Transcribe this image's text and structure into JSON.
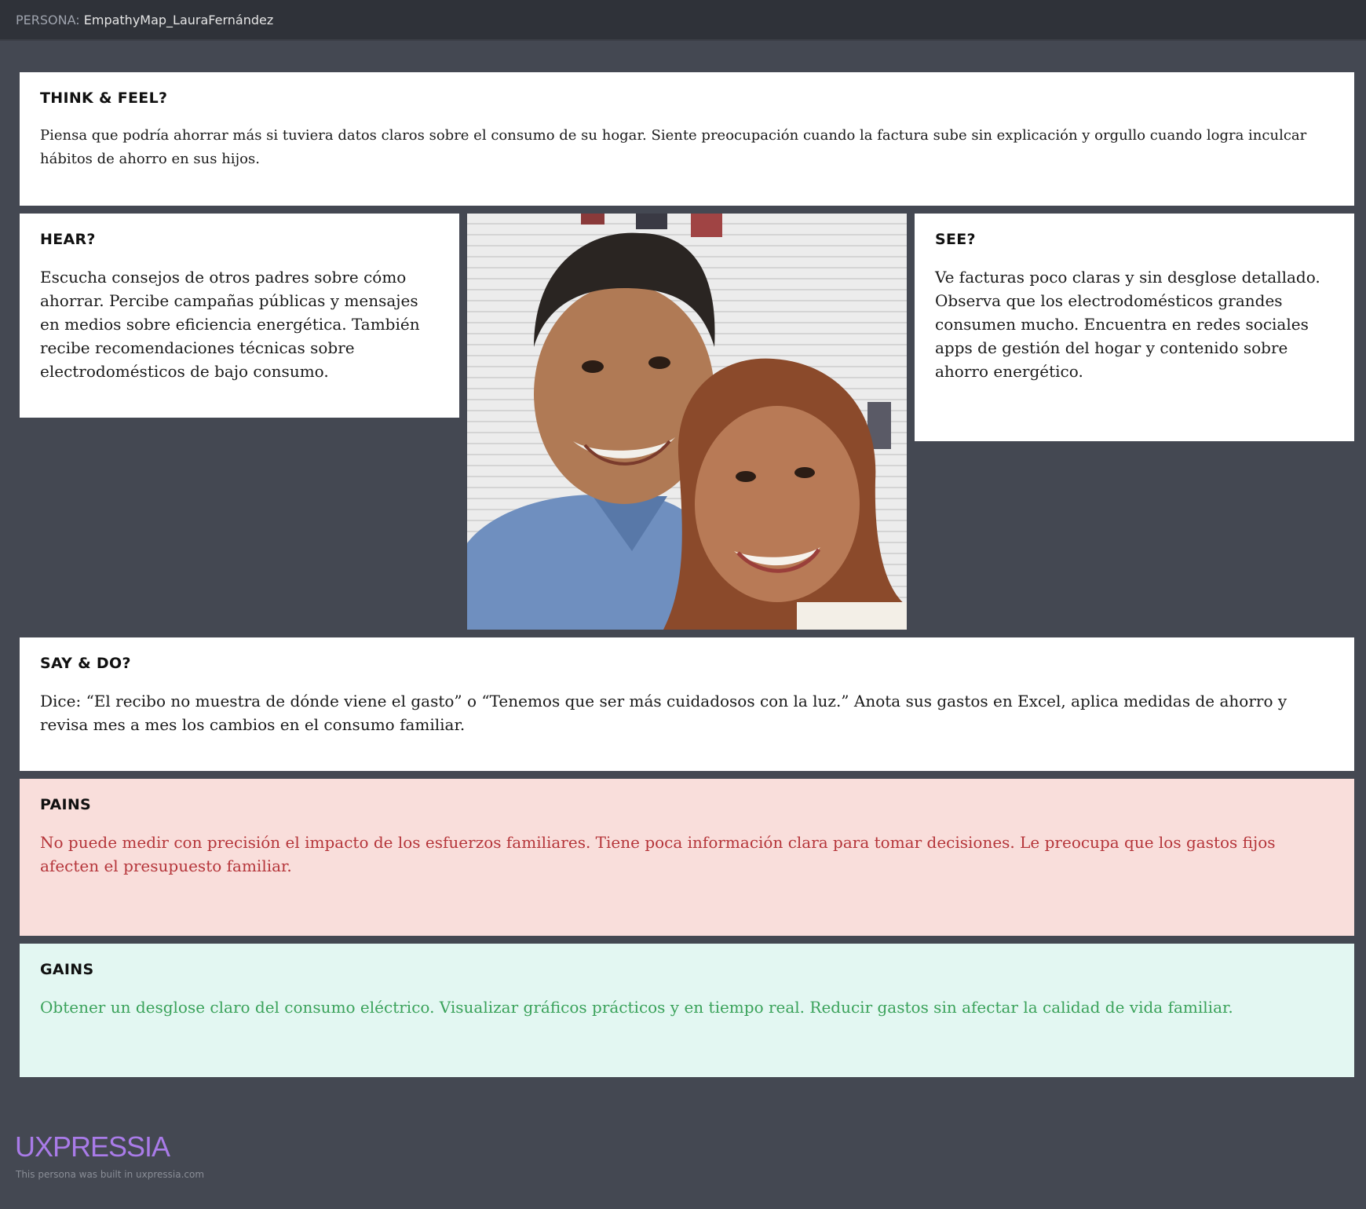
{
  "header": {
    "prefix": "PERSONA:",
    "name": "EmpathyMap_LauraFernández"
  },
  "sections": {
    "think_feel": {
      "title": "THINK & FEEL?",
      "text": "Piensa que podría ahorrar más si tuviera datos claros sobre el consumo de su hogar. Siente preocupación cuando la factura sube sin explicación y orgullo cuando logra inculcar hábitos de ahorro en sus hijos."
    },
    "hear": {
      "title": "HEAR?",
      "text": "Escucha consejos de otros padres sobre cómo ahorrar. Percibe campañas públicas y mensajes en medios sobre eficiencia energética. También recibe recomendaciones técnicas sobre electrodomésticos de bajo consumo."
    },
    "see": {
      "title": "SEE?",
      "text": "Ve facturas poco claras y sin desglose detallado. Observa que los electrodomésticos grandes consumen mucho. Encuentra en redes sociales apps de gestión del hogar y contenido sobre ahorro energético."
    },
    "say_do": {
      "title": "SAY & DO?",
      "text": "Dice: “El recibo no muestra de dónde viene el gasto” o “Tenemos que ser más cuidadosos con la luz.” Anota sus gastos en Excel, aplica medidas de ahorro y revisa mes a mes los cambios en el consumo familiar."
    },
    "pains": {
      "title": "PAINS",
      "text": "No puede medir con precisión el impacto de los esfuerzos familiares. Tiene poca información clara para tomar decisiones. Le preocupa que los gastos fijos afecten el presupuesto familiar."
    },
    "gains": {
      "title": "GAINS",
      "text": "Obtener un desglose claro del consumo eléctrico. Visualizar gráficos prácticos y en tiempo real. Reducir gastos sin afectar la calidad de vida familiar."
    }
  },
  "footer": {
    "logo": "UXPRESSIA",
    "note": "This persona was built in uxpressia.com"
  },
  "colors": {
    "background": "#444852",
    "topbar": "#2f3239",
    "pains_bg": "#f9dedb",
    "pains_text": "#b5353a",
    "gains_bg": "#e3f7f2",
    "gains_text": "#3aa25a",
    "logo": "#a97be8"
  }
}
